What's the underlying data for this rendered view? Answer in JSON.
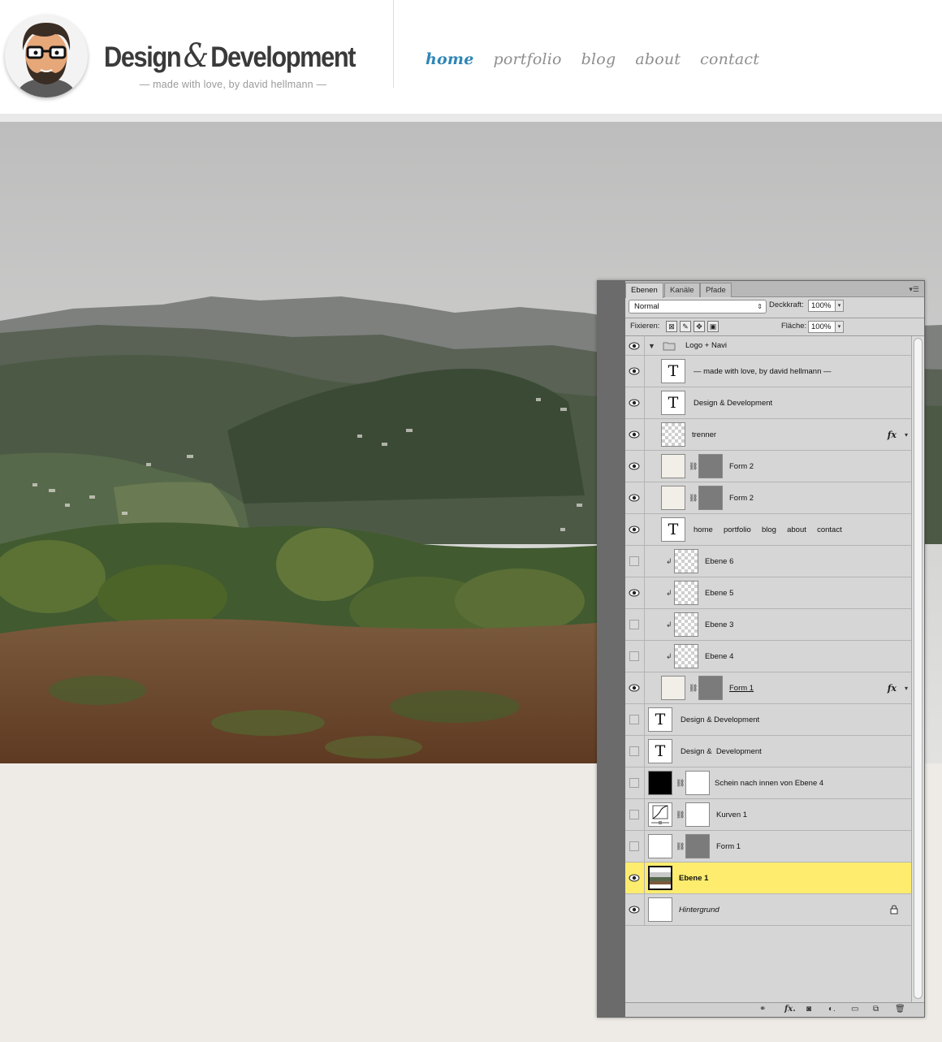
{
  "site": {
    "title_left": "Design",
    "title_amp": "&",
    "title_right": "Development",
    "tagline": "— made with love, by david hellmann —",
    "nav": [
      {
        "label": "home",
        "active": true
      },
      {
        "label": "portfolio",
        "active": false
      },
      {
        "label": "blog",
        "active": false
      },
      {
        "label": "about",
        "active": false
      },
      {
        "label": "contact",
        "active": false
      }
    ],
    "accent_color": "#2f86b6"
  },
  "panel": {
    "tabs": [
      "Ebenen",
      "Kanäle",
      "Pfade"
    ],
    "blend_mode": "Normal",
    "opacity_label": "Deckkraft:",
    "opacity_value": "100%",
    "fix_label": "Fixieren:",
    "fill_label": "Fläche:",
    "fill_value": "100%",
    "layers": [
      {
        "name": "Logo + Navi",
        "visible": true
      },
      {
        "name": "— made with love, by david hellmann —",
        "visible": true
      },
      {
        "name": "Design & Development",
        "visible": true
      },
      {
        "name": "trenner",
        "visible": true,
        "fx": "fx"
      },
      {
        "name": "Form 2",
        "visible": true
      },
      {
        "name": "Form 2",
        "visible": true
      },
      {
        "name": "home     portfolio     blog     about     contact",
        "visible": true
      },
      {
        "name": "Ebene 6",
        "visible": false
      },
      {
        "name": "Ebene 5",
        "visible": true
      },
      {
        "name": "Ebene 3",
        "visible": false
      },
      {
        "name": "Ebene 4",
        "visible": false
      },
      {
        "name": "Form 1",
        "visible": true,
        "fx": "fx"
      },
      {
        "name": "Design & Development",
        "visible": false
      },
      {
        "name": "Design &  Development",
        "visible": false
      },
      {
        "name": "Schein nach innen von Ebene 4",
        "visible": false
      },
      {
        "name": "Kurven 1",
        "visible": false
      },
      {
        "name": "Form 1",
        "visible": false
      },
      {
        "name": "Ebene 1",
        "visible": true,
        "selected": true
      },
      {
        "name": "Hintergrund",
        "visible": true,
        "locked": true
      }
    ],
    "bottom_icons": [
      "link-icon",
      "fx-icon",
      "mask-icon",
      "adjustment-icon",
      "folder-icon",
      "new-layer-icon",
      "trash-icon"
    ],
    "selected_color": "#fdec6e"
  }
}
